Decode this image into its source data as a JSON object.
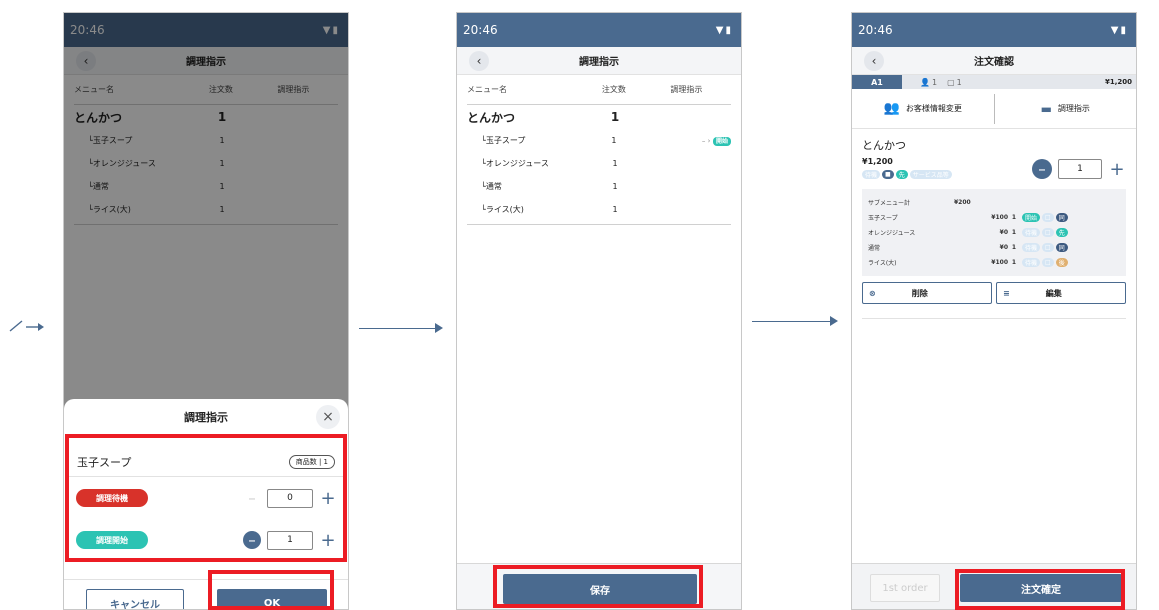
{
  "status": {
    "time": "20:46",
    "icons": "▼▮"
  },
  "colors": {
    "primary": "#4a6a8f",
    "highlight": "#ec1c24",
    "wait": "#d8322a",
    "start": "#2cc3b3"
  },
  "screen1": {
    "title": "調理指示",
    "columns": {
      "name": "メニュー名",
      "count": "注文数",
      "instruction": "調理指示"
    },
    "main_item": {
      "name": "とんかつ",
      "count": "1"
    },
    "sub_items": [
      {
        "name": "└玉子スープ",
        "count": "1"
      },
      {
        "name": "└オレンジジュース",
        "count": "1"
      },
      {
        "name": "└通常",
        "count": "1"
      },
      {
        "name": "└ライス(大)",
        "count": "1"
      }
    ],
    "sheet": {
      "title": "調理指示",
      "close_icon": "close-icon",
      "item_name": "玉子スープ",
      "qty_badge": "商品数 | 1",
      "wait_label": "調理待機",
      "wait_value": "0",
      "start_label": "調理開始",
      "start_value": "1",
      "cancel_label": "キャンセル",
      "ok_label": "OK"
    }
  },
  "screen2": {
    "title": "調理指示",
    "columns": {
      "name": "メニュー名",
      "count": "注文数",
      "instruction": "調理指示"
    },
    "main_item": {
      "name": "とんかつ",
      "count": "1"
    },
    "sub_items": [
      {
        "name": "└玉子スープ",
        "count": "1",
        "status": "開始",
        "prefix": "– ›"
      },
      {
        "name": "└オレンジジュース",
        "count": "1"
      },
      {
        "name": "└通常",
        "count": "1"
      },
      {
        "name": "└ライス(大)",
        "count": "1"
      }
    ],
    "save_label": "保存"
  },
  "screen3": {
    "title": "注文確認",
    "table": "A1",
    "guests": "1",
    "orders": "1",
    "total": "¥1,200",
    "customer_change": "お客様情報変更",
    "cook_instruction": "調理指示",
    "item_name": "とんかつ",
    "item_price": "¥1,200",
    "item_chips": [
      "待機",
      "■",
      "先",
      "サービス品等"
    ],
    "qty": "1",
    "subtotal_label": "サブメニュー計",
    "subtotal_value": "¥200",
    "sub_rows": [
      {
        "name": "玉子スープ",
        "price": "¥100",
        "qty": "1",
        "c1": "開始",
        "c2": "□",
        "c3": "同"
      },
      {
        "name": "オレンジジュース",
        "price": "¥0",
        "qty": "1",
        "c1": "待機",
        "c2": "□",
        "c3": "先"
      },
      {
        "name": "通常",
        "price": "¥0",
        "qty": "1",
        "c1": "待機",
        "c2": "□",
        "c3": "同"
      },
      {
        "name": "ライス(大)",
        "price": "¥100",
        "qty": "1",
        "c1": "待機",
        "c2": "□",
        "c3": "後"
      }
    ],
    "delete_label": "削除",
    "edit_label": "編集",
    "first_order_label": "1st order",
    "confirm_label": "注文確定"
  }
}
